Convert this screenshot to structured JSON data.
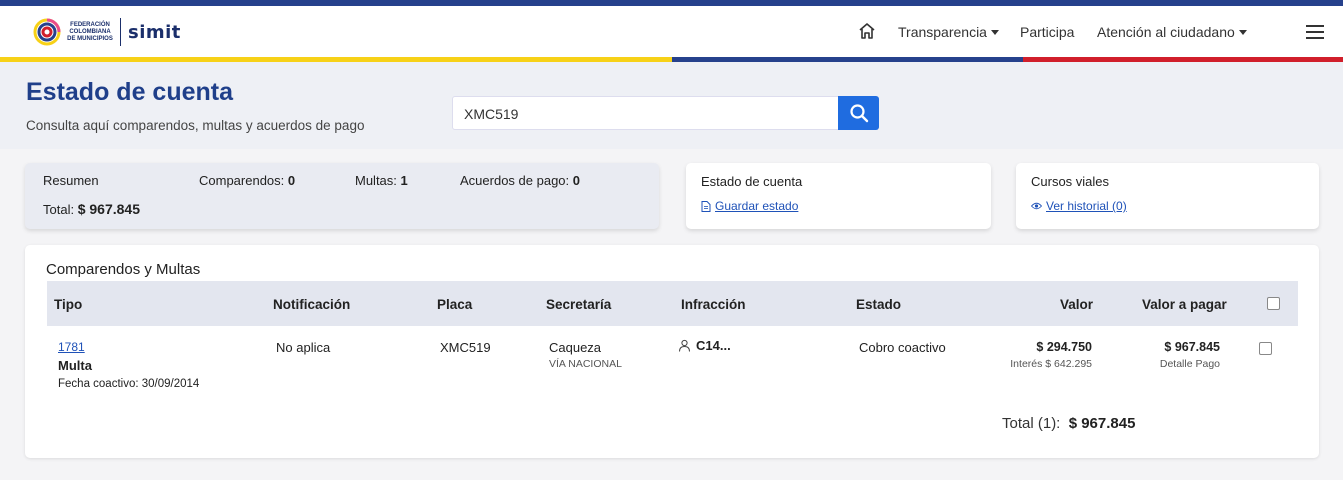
{
  "header": {
    "logo_text": "FEDERACIÓN COLOMBIANA DE MUNICIPIOS",
    "logo_brand": "simit",
    "nav": [
      {
        "label": "Transparencia",
        "has_caret": true
      },
      {
        "label": "Participa",
        "has_caret": false
      },
      {
        "label": "Atención al ciudadano",
        "has_caret": true
      }
    ],
    "icons": {
      "home": "home-icon",
      "menu": "hamburger-menu-icon"
    }
  },
  "page": {
    "title": "Estado de cuenta",
    "subtitle": "Consulta aquí comparendos, multas y acuerdos de pago"
  },
  "search": {
    "value": "XMC519",
    "button_icon": "search-icon"
  },
  "summary": {
    "label": "Resumen",
    "comparendos_label": "Comparendos:",
    "comparendos_value": "0",
    "multas_label": "Multas:",
    "multas_value": "1",
    "acuerdos_label": "Acuerdos de pago:",
    "acuerdos_value": "0",
    "total_label": "Total:",
    "total_value": "$ 967.845"
  },
  "estado_card": {
    "title": "Estado de cuenta",
    "link": "Guardar estado"
  },
  "cursos_card": {
    "title": "Cursos viales",
    "link": "Ver historial (0)"
  },
  "table": {
    "title": "Comparendos y Multas",
    "headers": {
      "tipo": "Tipo",
      "notificacion": "Notificación",
      "placa": "Placa",
      "secretaria": "Secretaría",
      "infraccion": "Infracción",
      "estado": "Estado",
      "valor": "Valor",
      "valor_pagar": "Valor a pagar"
    },
    "rows": [
      {
        "numero": "1781",
        "tipo": "Multa",
        "fecha": "Fecha coactivo: 30/09/2014",
        "notificacion": "No aplica",
        "placa": "XMC519",
        "secretaria": "Caqueza",
        "via": "VÍA NACIONAL",
        "infraccion": "C14...",
        "estado": "Cobro coactivo",
        "valor": "$ 294.750",
        "interes": "Interés $ 642.295",
        "valor_pagar": "$ 967.845",
        "detalle": "Detalle Pago"
      }
    ],
    "total_label": "Total (1):",
    "total_value": "$ 967.845"
  },
  "colors": {
    "primary_blue": "#1f3f8a",
    "button_blue": "#1f6ce0",
    "flag_yellow": "#f7d117",
    "flag_blue": "#26418c",
    "flag_red": "#d11f2b"
  }
}
